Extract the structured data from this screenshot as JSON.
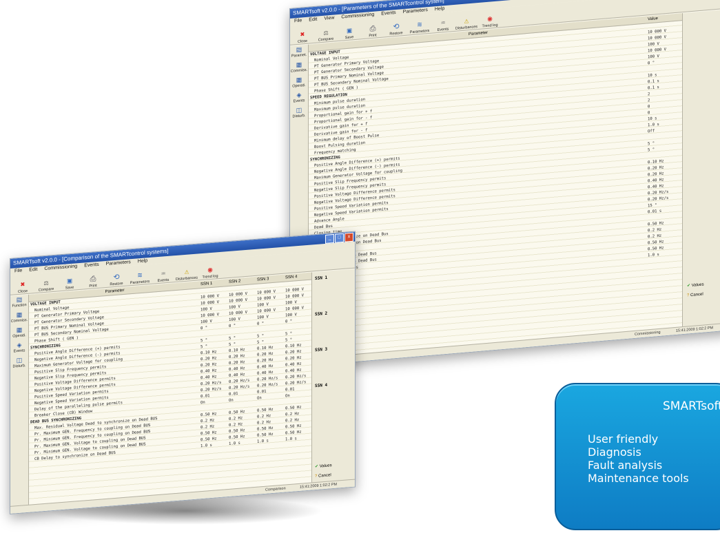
{
  "back_window": {
    "title": "SMARTsoft v2.0.0 - [Parameters of the SMARTcontrol system]",
    "menu": [
      "File",
      "Edit",
      "View",
      "Commissioning",
      "Events",
      "Parameters",
      "Help"
    ],
    "toolbar": [
      "Close",
      "Compare",
      "Save",
      "Print",
      "Restore",
      "Parameters",
      "Events",
      "Disturbances",
      "Trend log"
    ],
    "left_nav": [
      "Paramet.",
      "Commiss.",
      "Operati.",
      "Events",
      "Disturb."
    ],
    "column_label": "Parameter",
    "value_header": "Value",
    "rows": [
      {
        "name": "VOLTAGE INPUT",
        "value": "",
        "section": true
      },
      {
        "name": "Nominal Voltage",
        "value": "10 000 V"
      },
      {
        "name": "PT Generator Primary Voltage",
        "value": "10 000 V"
      },
      {
        "name": "PT Generator Secondary Voltage",
        "value": "100 V"
      },
      {
        "name": "PT BUS Primary Nominal Voltage",
        "value": "10 000 V"
      },
      {
        "name": "PT BUS Secondary Nominal Voltage",
        "value": "100 V"
      },
      {
        "name": "Phase Shift ( GEN )",
        "value": "0 °"
      },
      {
        "name": "SPEED REGULATION",
        "value": "",
        "section": true
      },
      {
        "name": "Minimum pulse duration",
        "value": "10 s"
      },
      {
        "name": "Maximum pulse duration",
        "value": "0.1 s"
      },
      {
        "name": "Proportional gain for + f",
        "value": "0.1 s"
      },
      {
        "name": "Proportional gain for - f",
        "value": "2"
      },
      {
        "name": "Derivative gain for + f",
        "value": "2"
      },
      {
        "name": "Derivative gain for - f",
        "value": "0"
      },
      {
        "name": "Minimum delay of Boost Pulse",
        "value": "0"
      },
      {
        "name": "Boost Pulsing duration",
        "value": "10 s"
      },
      {
        "name": "Frequency matching",
        "value": "1.0 s"
      },
      {
        "name": "SYNCHRONIZING",
        "value": "Off",
        "section": true
      },
      {
        "name": "Positive Angle Difference (+) permits",
        "value": ""
      },
      {
        "name": "Negative Angle Difference (-) permits",
        "value": "5 °"
      },
      {
        "name": "Maximum Generator Voltage for coupling",
        "value": "5 °"
      },
      {
        "name": "Positive Slip Frequency permits",
        "value": ""
      },
      {
        "name": "Negative Slip Frequency permits",
        "value": "0.10 Hz"
      },
      {
        "name": "Positive Voltage Difference permits",
        "value": "0.20 Hz"
      },
      {
        "name": "Negative Voltage Difference permits",
        "value": "0.20 Hz"
      },
      {
        "name": "Positive Speed Variation permits",
        "value": "0.40 Hz"
      },
      {
        "name": "Negative Speed Variation permits",
        "value": "0.40 Hz"
      },
      {
        "name": "Advance Angle",
        "value": "0.20 Hz/s"
      },
      {
        "name": "Dead Bus",
        "value": "0.20 Hz/s"
      },
      {
        "name": "Closing time",
        "value": "15 °"
      },
      {
        "name": "Pulse to synchronize on Dead Bus",
        "value": "0.01 s"
      },
      {
        "name": "Delay to coupling on Dead Bus",
        "value": ""
      },
      {
        "name": "Delay by Dead bus",
        "value": "0.50 Hz"
      },
      {
        "name": "Max to coupling on Dead Bus",
        "value": "0.2 Hz"
      },
      {
        "name": "Min to coupling on Dead Bus",
        "value": "0.2 Hz"
      },
      {
        "name": "Voltage on Dead Bus",
        "value": "0.50 Hz"
      },
      {
        "name": "",
        "value": "0.50 Hz"
      },
      {
        "name": "",
        "value": "1.0 s"
      }
    ],
    "right_buttons": [
      "Values",
      "Cancel"
    ],
    "status": "Commissioning",
    "status_time": "15:41:2009 1:02:2 PM"
  },
  "front_window": {
    "title": "SMARTsoft v2.0.0 - [Comparison of the SMARTcontrol systems]",
    "menu": [
      "File",
      "Edit",
      "Commissioning",
      "Events",
      "Parameters",
      "Help"
    ],
    "toolbar": [
      "Close",
      "Compare",
      "Save",
      "Print",
      "Restore",
      "Parameters",
      "Events",
      "Disturbances",
      "Trend log"
    ],
    "left_nav": [
      "Function",
      "Commiss.",
      "Operati.",
      "Events",
      "Disturb."
    ],
    "column_label": "Parameter",
    "headers": [
      "SSN 1",
      "SSN 2",
      "SSN 3",
      "SSN 4"
    ],
    "right_labels": [
      "SSN 1",
      "SSN 2",
      "SSN 3",
      "SSN 4"
    ],
    "rows": [
      {
        "name": "VOLTAGE INPUT",
        "values": [
          "",
          "",
          "",
          ""
        ],
        "section": true
      },
      {
        "name": "Nominal Voltage",
        "values": [
          "10 000 V",
          "10 000 V",
          "10 000 V",
          "10 000 V"
        ]
      },
      {
        "name": "PT Generator Primary Voltage",
        "values": [
          "10 000 V",
          "10 000 V",
          "10 000 V",
          "10 000 V"
        ]
      },
      {
        "name": "PT Generator Secondary Voltage",
        "values": [
          "100 V",
          "100 V",
          "100 V",
          "100 V"
        ]
      },
      {
        "name": "PT BUS Primary Nominal Voltage",
        "values": [
          "10 000 V",
          "10 000 V",
          "10 000 V",
          "10 000 V"
        ]
      },
      {
        "name": "PT BUS Secondary Nominal Voltage",
        "values": [
          "100 V",
          "100 V",
          "100 V",
          "100 V"
        ]
      },
      {
        "name": "Phase Shift ( GEN )",
        "values": [
          "0 °",
          "0 °",
          "0 °",
          "0 °"
        ]
      },
      {
        "name": "SYNCHRONIZING",
        "values": [
          "",
          "",
          "",
          ""
        ],
        "section": true
      },
      {
        "name": "Positive Angle Difference (+) permits",
        "values": [
          "5 °",
          "5 °",
          "5 °",
          "5 °"
        ]
      },
      {
        "name": "Negative Angle Difference (-) permits",
        "values": [
          "5 °",
          "5 °",
          "5 °",
          "5 °"
        ]
      },
      {
        "name": "Maximum Generator Voltage for coupling",
        "values": [
          "0.10 Hz",
          "0.10 Hz",
          "0.10 Hz",
          "0.10 Hz"
        ]
      },
      {
        "name": "Positive Slip Frequency permits",
        "values": [
          "0.20 Hz",
          "0.20 Hz",
          "0.20 Hz",
          "0.20 Hz"
        ]
      },
      {
        "name": "Negative Slip Frequency permits",
        "values": [
          "0.20 Hz",
          "0.20 Hz",
          "0.20 Hz",
          "0.20 Hz"
        ]
      },
      {
        "name": "Positive Voltage Difference permits",
        "values": [
          "0.40 Hz",
          "0.40 Hz",
          "0.40 Hz",
          "0.40 Hz"
        ]
      },
      {
        "name": "Negative Voltage Difference permits",
        "values": [
          "0.40 Hz",
          "0.40 Hz",
          "0.40 Hz",
          "0.40 Hz"
        ]
      },
      {
        "name": "Positive Speed Variation permits",
        "values": [
          "0.20 Hz/s",
          "0.20 Hz/s",
          "0.20 Hz/s",
          "0.20 Hz/s"
        ]
      },
      {
        "name": "Negative Speed Variation permits",
        "values": [
          "0.20 Hz/s",
          "0.20 Hz/s",
          "0.20 Hz/s",
          "0.20 Hz/s"
        ]
      },
      {
        "name": "Delay of the paralleling pulse permits",
        "values": [
          "0.01",
          "0.01",
          "0.01",
          "0.01"
        ]
      },
      {
        "name": "Breaker Close (CB) Window",
        "values": [
          "On",
          "On",
          "On",
          "On"
        ]
      },
      {
        "name": "DEAD BUS SYNCHRONIZING",
        "values": [
          "",
          "",
          "",
          ""
        ],
        "section": true
      },
      {
        "name": "Max. Residual Voltage Dead to synchronize on Dead BUS",
        "values": [
          "0.50 Hz",
          "0.50 Hz",
          "0.50 Hz",
          "0.50 Hz"
        ]
      },
      {
        "name": "Pr. Maximum GEN. Frequency to coupling on Dead BUS",
        "values": [
          "0.2 Hz",
          "0.2 Hz",
          "0.2 Hz",
          "0.2 Hz"
        ]
      },
      {
        "name": "Pr. Minimum GEN. Frequency to coupling on Dead BUS",
        "values": [
          "0.2 Hz",
          "0.2 Hz",
          "0.2 Hz",
          "0.2 Hz"
        ]
      },
      {
        "name": "Pr. Maximum GEN. Voltage to coupling on Dead BUS",
        "values": [
          "0.50 Hz",
          "0.50 Hz",
          "0.50 Hz",
          "0.50 Hz"
        ]
      },
      {
        "name": "Pr. Minimum GEN. Voltage to coupling on Dead BUS",
        "values": [
          "0.50 Hz",
          "0.50 Hz",
          "0.50 Hz",
          "0.50 Hz"
        ]
      },
      {
        "name": "CB Delay to synchronize on Dead BUS",
        "values": [
          "1.0 s",
          "1.0 s",
          "1.0 s",
          "1.0 s"
        ]
      }
    ],
    "right_buttons": [
      "Values",
      "Cancel"
    ],
    "status": "Comparison",
    "status_time": "15:41:2009 1:02:2 PM"
  },
  "promo": {
    "title": "SMARTsoft",
    "items": [
      "User friendly",
      "Diagnosis",
      "Fault analysis",
      "Maintenance tools"
    ]
  },
  "colors": {
    "promo_bg": "#1aa7e0",
    "titlebar": "#2452a8",
    "grid_bg": "#fbf9ee"
  }
}
